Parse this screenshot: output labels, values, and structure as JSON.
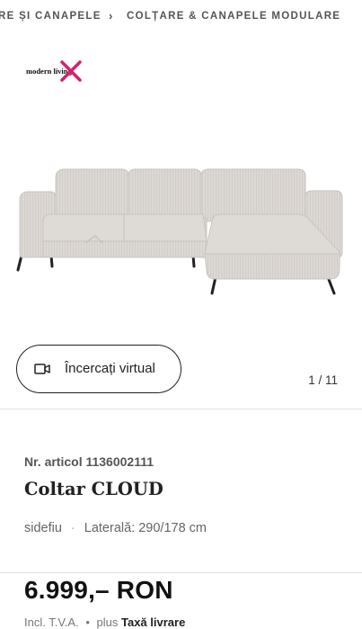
{
  "breadcrumb": {
    "item1": "RE ȘI CANAPELE",
    "separator": "›",
    "item2": "COLȚARE & CANAPELE MODULARE"
  },
  "brand": {
    "logo_text": "modern living",
    "accent_color": "#d6206b"
  },
  "gallery": {
    "image_icon": "sofa-product-image",
    "counter": "1 / 11"
  },
  "ar_button": {
    "label": "Încercați virtual",
    "icon": "video-camera-icon"
  },
  "product": {
    "article_number": "Nr. articol 1136002111",
    "title_bold": "Coltar",
    "title_regular": "CLOUD",
    "variant": "sidefiu",
    "separator": "·",
    "dimension": "Laterală: 290/178 cm"
  },
  "price": {
    "value": "6.999,– RON",
    "vat_note": "Incl. T.V.A.",
    "bullet": "•",
    "plus": "plus",
    "delivery_link": "Taxă livrare"
  }
}
